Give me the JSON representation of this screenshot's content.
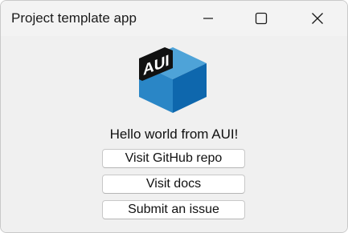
{
  "window": {
    "title": "Project template app"
  },
  "controls": {
    "minimize_icon": "minimize-icon",
    "maximize_icon": "maximize-icon",
    "close_icon": "close-icon"
  },
  "logo": {
    "text": "AUI",
    "colors": {
      "top": "#4ea3d8",
      "left": "#1f7fc2",
      "right": "#0f5c9e",
      "label_bg": "#111111",
      "label_text": "#ffffff"
    }
  },
  "main": {
    "greeting": "Hello world from AUI!",
    "buttons": [
      {
        "label": "Visit GitHub repo"
      },
      {
        "label": "Visit docs"
      },
      {
        "label": "Submit an issue"
      }
    ]
  }
}
